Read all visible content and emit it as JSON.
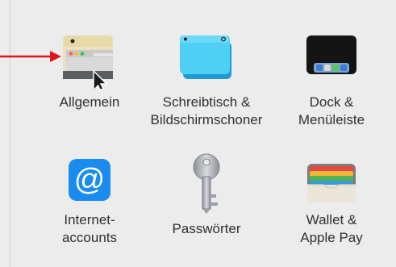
{
  "panes": [
    {
      "id": "general",
      "line1": "Allgemein",
      "line2": "",
      "icon": "general-window-icon"
    },
    {
      "id": "desktop",
      "line1": "Schreibtisch &",
      "line2": "Bildschirmschoner",
      "icon": "desktop-screensaver-icon"
    },
    {
      "id": "dock",
      "line1": "Dock &",
      "line2": "Menüleiste",
      "icon": "dock-menubar-icon"
    },
    {
      "id": "internet-accounts",
      "line1": "Internet-",
      "line2": "accounts",
      "icon": "at-sign-icon"
    },
    {
      "id": "passwords",
      "line1": "Passwörter",
      "line2": "",
      "icon": "key-icon"
    },
    {
      "id": "wallet",
      "line1": "Wallet &",
      "line2": "Apple Pay",
      "icon": "wallet-icon"
    }
  ],
  "colors": {
    "background": "#ececec",
    "label": "#303030",
    "annotation_arrow": "#e0141e",
    "at_blue": "#1a8cf0",
    "desktop_cyan": "#3fc4ee"
  }
}
